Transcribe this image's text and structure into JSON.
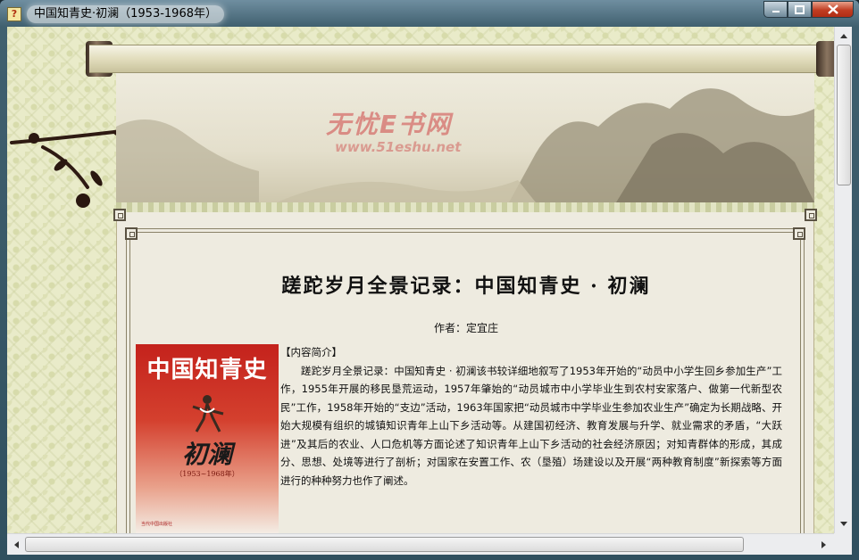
{
  "window": {
    "title": "中国知青史·初澜（1953-1968年）",
    "app_icon": "help-document-icon",
    "controls": {
      "minimize_icon": "minimize-icon",
      "maximize_icon": "maximize-icon",
      "close_icon": "close-icon"
    }
  },
  "banner": {
    "watermark_name": "无忧E书网",
    "watermark_url": "www.51eshu.net"
  },
  "book": {
    "title": "蹉跎岁月全景记录：中国知青史 · 初澜",
    "author": "作者：定宜庄",
    "cover": {
      "title": "中国知青史",
      "subtitle": "初澜",
      "years": "（1953~1968年）",
      "publisher": "当代中国出版社"
    },
    "intro_heading": "【内容简介】",
    "intro_body": "蹉跎岁月全景记录：中国知青史 · 初澜该书较详细地叙写了1953年开始的“动员中小学生回乡参加生产”工作，1955年开展的移民垦荒运动，1957年肇始的“动员城市中小学毕业生到农村安家落户、做第一代新型农民”工作，1958年开始的“支边”活动，1963年国家把“动员城市中学毕业生参加农业生产”确定为长期战略、开始大规模有组织的城镇知识青年上山下乡活动等。从建国初经济、教育发展与升学、就业需求的矛盾，“大跃进”及其后的农业、人口危机等方面论述了知识青年上山下乡活动的社会经济原因；对知青群体的形成，其成分、思想、处境等进行了剖析；对国家在安置工作、农（垦殖）场建设以及开展“两种教育制度”新探索等方面进行的种种努力也作了阐述。"
  },
  "scrollbars": {
    "up_icon": "up-arrow-icon",
    "down_icon": "down-arrow-icon",
    "left_icon": "left-arrow-icon",
    "right_icon": "right-arrow-icon"
  },
  "colors": {
    "paper": "#eeebe0",
    "background_pattern": "#e9ebc9",
    "cover_red": "#c4221c",
    "close_button": "#c13d22"
  }
}
